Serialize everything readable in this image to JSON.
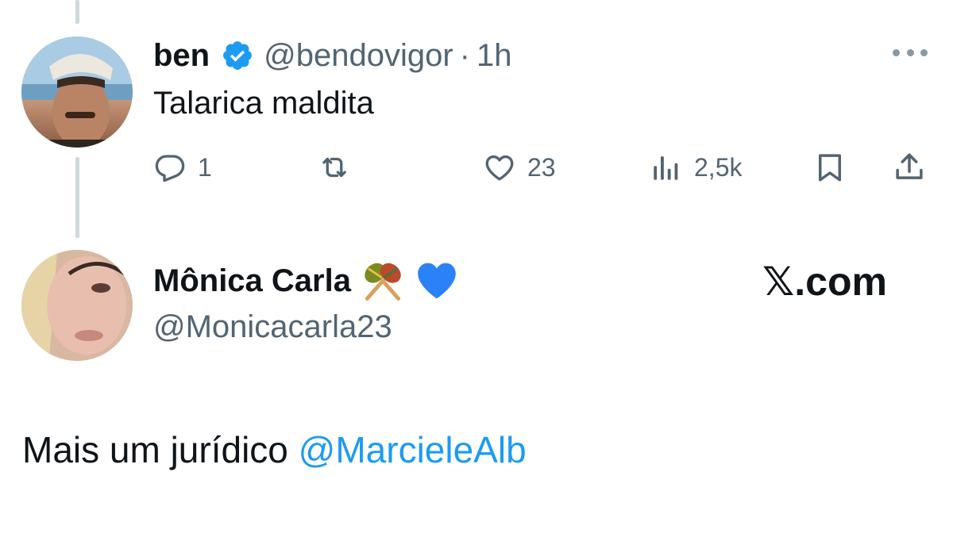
{
  "tweet": {
    "author_name": "ben",
    "author_handle": "@bendovigor",
    "separator": "·",
    "time": "1h",
    "text": "Talarica maldita",
    "verified_icon": "verified-badge-icon",
    "actions": {
      "reply_count": "1",
      "retweet_count": "",
      "like_count": "23",
      "views_count": "2,5k"
    }
  },
  "quote": {
    "name": "Mônica Carla",
    "handle": "@Monicacarla23",
    "emojis": [
      "maracas-emoji",
      "blue-heart-emoji"
    ],
    "brand": "𝕏.com"
  },
  "caption": {
    "text": "Mais um jurídico ",
    "mention": "@MarcieleAlb"
  },
  "colors": {
    "verified": "#1d9bf0",
    "mention": "#1d9bf0",
    "secondary_text": "#536471",
    "blue_heart": "#2b82f6"
  }
}
